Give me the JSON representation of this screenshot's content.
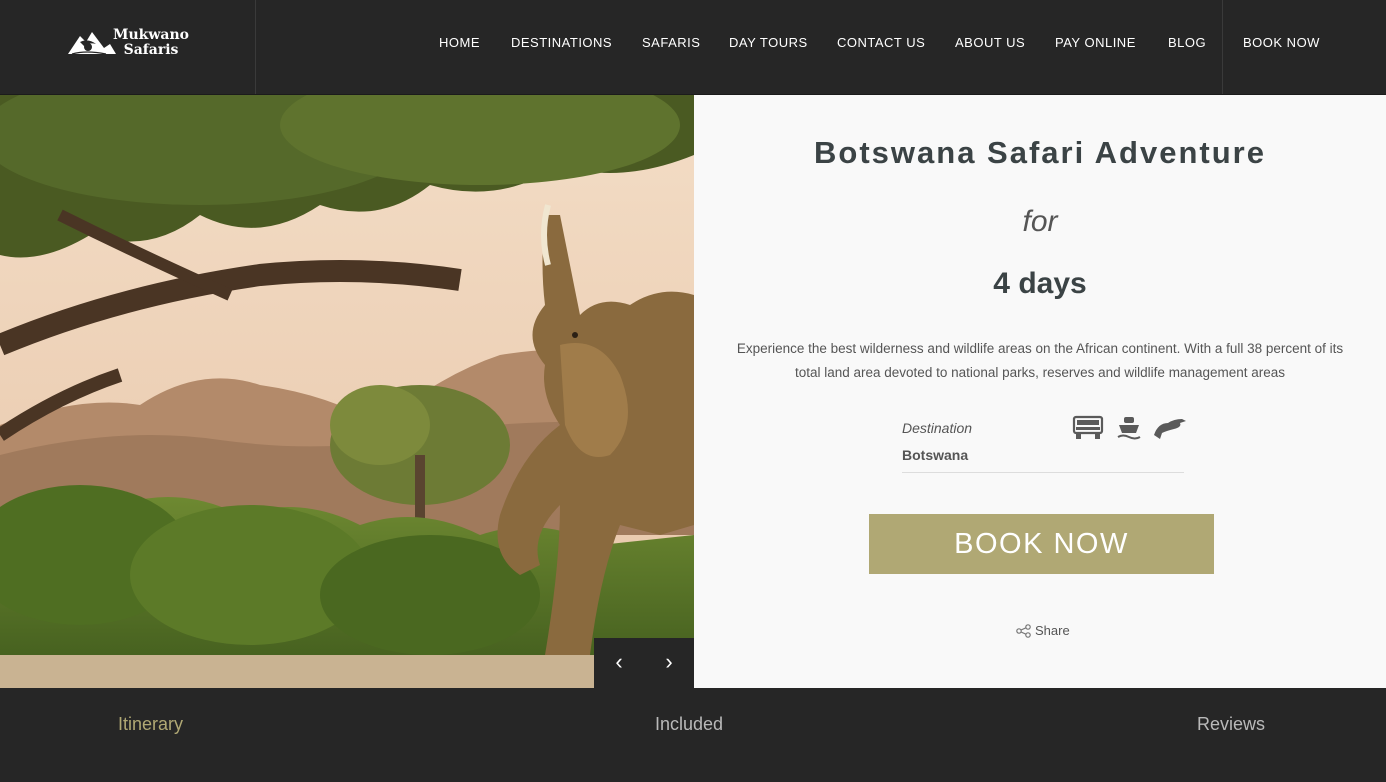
{
  "brand": {
    "logo_line1": "Mukwano",
    "logo_line2": "Safaris"
  },
  "nav": {
    "items": [
      "HOME",
      "DESTINATIONS",
      "SAFARIS",
      "DAY TOURS",
      "CONTACT US",
      "ABOUT US",
      "PAY ONLINE",
      "BLOG"
    ],
    "book_now": "BOOK NOW"
  },
  "slider": {
    "prev_icon": "chevron-left-icon",
    "next_icon": "chevron-right-icon",
    "prev_glyph": "‹",
    "next_glyph": "›"
  },
  "tour": {
    "title": "Botswana Safari Adventure",
    "for_text": "for",
    "duration": "4 days",
    "description": "Experience the best wilderness and wildlife areas on the African continent. With a full 38 percent of its total land area devoted to national parks, reserves and wildlife management areas",
    "destination_label": "Destination",
    "destination_value": "Botswana",
    "icons": [
      "safari-vehicle-icon",
      "boat-icon",
      "bird-icon"
    ],
    "book_button": "BOOK NOW",
    "share_label": "Share"
  },
  "tabs": [
    {
      "label": "Itinerary",
      "active": true
    },
    {
      "label": "Included",
      "active": false
    },
    {
      "label": "Reviews",
      "active": false
    }
  ],
  "colors": {
    "header_bg": "#262626",
    "accent": "#b0a874",
    "panel_bg": "#f9f9f9",
    "title_text": "#3b4345"
  }
}
